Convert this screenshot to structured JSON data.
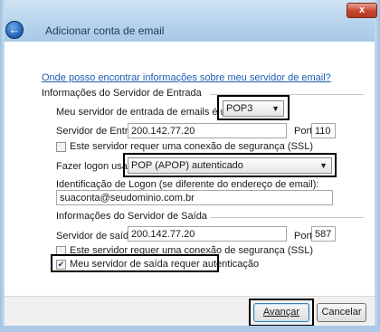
{
  "window": {
    "title": "Adicionar conta de email",
    "close_label": "x"
  },
  "help_link": "Onde posso encontrar informações sobre meu servidor de email?",
  "incoming": {
    "section_title": "Informações do Servidor de Entrada",
    "server_type_label": "Meu servidor de entrada de emails é um servidor",
    "server_type_value": "POP3",
    "server_label": "Servidor de Entrada:",
    "server_value": "200.142.77.20",
    "port_label": "Porta:",
    "port_value": "110",
    "ssl_label": "Este servidor requer uma conexão de segurança (SSL)",
    "ssl_checked": false,
    "logon_label": "Fazer logon usando:",
    "logon_value": "POP (APOP) autenticado",
    "logon_id_label": "Identificação de Logon (se diferente do endereço de email):",
    "logon_id_value": "suaconta@seudominio.com.br"
  },
  "outgoing": {
    "section_title": "Informações do Servidor de Saída",
    "server_label": "Servidor de saída:",
    "server_value": "200.142.77.20",
    "port_label": "Porta:",
    "port_value": "587",
    "ssl_label": "Este servidor requer uma conexão de segurança (SSL)",
    "ssl_checked": false,
    "auth_label": "Meu servidor de saída requer autenticação",
    "auth_checked": true
  },
  "buttons": {
    "next": "Avançar",
    "cancel": "Cancelar"
  },
  "icons": {
    "back": "back-arrow-icon",
    "dropdown": "chevron-down-icon",
    "check": "checkmark-icon"
  }
}
